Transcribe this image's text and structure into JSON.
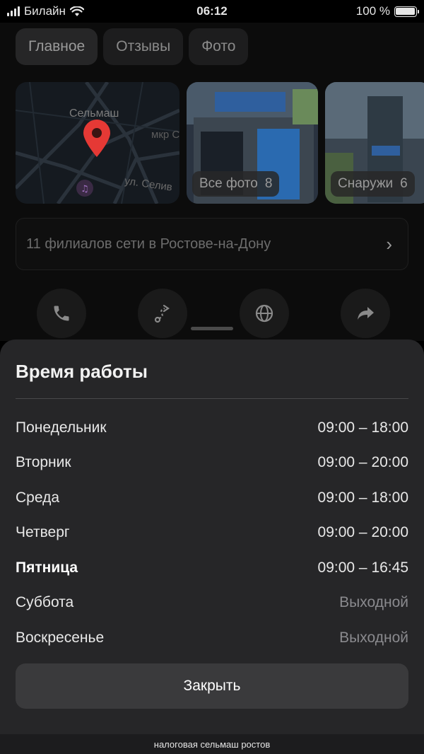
{
  "status": {
    "carrier": "Билайн",
    "time": "06:12",
    "battery": "100 %"
  },
  "tabs": [
    {
      "label": "Главное"
    },
    {
      "label": "Отзывы"
    },
    {
      "label": "Фото"
    }
  ],
  "map": {
    "label_top": "Сельмаш",
    "label_area": "мкр С",
    "label_street": "ул. Селив"
  },
  "photos": [
    {
      "label": "Все фото",
      "count": "8"
    },
    {
      "label": "Снаружи",
      "count": "6"
    }
  ],
  "branches": {
    "text": "11 филиалов сети в Ростове-на-Дону"
  },
  "actions": [
    {
      "icon": "phone-icon"
    },
    {
      "icon": "route-icon"
    },
    {
      "icon": "globe-icon"
    },
    {
      "icon": "share-icon"
    }
  ],
  "sheet": {
    "title": "Время работы",
    "hours": [
      {
        "day": "Понедельник",
        "time": "09:00 – 18:00"
      },
      {
        "day": "Вторник",
        "time": "09:00 – 20:00"
      },
      {
        "day": "Среда",
        "time": "09:00 – 18:00"
      },
      {
        "day": "Четверг",
        "time": "09:00 – 20:00"
      },
      {
        "day": "Пятница",
        "time": "09:00 – 16:45"
      },
      {
        "day": "Суббота",
        "time": "Выходной"
      },
      {
        "day": "Воскресенье",
        "time": "Выходной"
      }
    ],
    "close_label": "Закрыть"
  },
  "bottom_bar": {
    "query": "налоговая сельмаш ростов"
  },
  "colors": {
    "sheet_bg": "#262628",
    "button_bg": "#3a3a3c",
    "marker": "#e53935"
  }
}
